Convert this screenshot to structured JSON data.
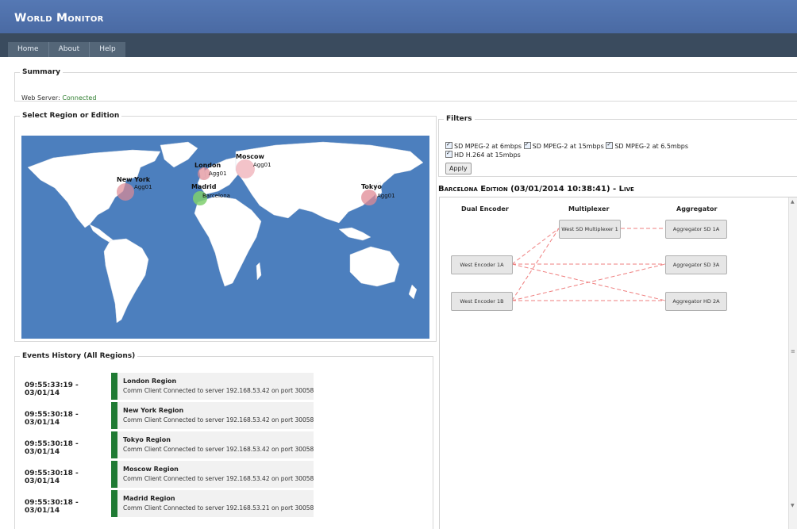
{
  "app": {
    "title": "World Monitor"
  },
  "nav": [
    "Home",
    "About",
    "Help"
  ],
  "summary": {
    "legend": "Summary",
    "web_server_label": "Web Server:",
    "web_server_status": "Connected"
  },
  "map": {
    "legend": "Select Region or Edition",
    "markers": [
      {
        "city": "New York",
        "agg": "Agg01"
      },
      {
        "city": "London",
        "agg": "Agg01"
      },
      {
        "city": "Moscow",
        "agg": "Agg01"
      },
      {
        "city": "Madrid",
        "agg": "Barcelona"
      },
      {
        "city": "Tokyo",
        "agg": "Agg01"
      }
    ],
    "colors": {
      "ocean": "#4c7fbe",
      "land": "#ffffff",
      "marker": "#e08a94",
      "selected": "#7fcf6f"
    }
  },
  "events": {
    "legend": "Events History (All Regions)",
    "items": [
      {
        "time": "09:55:33:19 - 03/01/14",
        "region": "London Region",
        "message": "Comm Client Connected to server 192.168.53.42 on port 30058"
      },
      {
        "time": "09:55:30:18 - 03/01/14",
        "region": "New York Region",
        "message": "Comm Client Connected to server 192.168.53.42 on port 30058"
      },
      {
        "time": "09:55:30:18 - 03/01/14",
        "region": "Tokyo Region",
        "message": "Comm Client Connected to server 192.168.53.42 on port 30058"
      },
      {
        "time": "09:55:30:18 - 03/01/14",
        "region": "Moscow Region",
        "message": "Comm Client Connected to server 192.168.53.42 on port 30058"
      },
      {
        "time": "09:55:30:18 - 03/01/14",
        "region": "Madrid Region",
        "message": "Comm Client Connected to server 192.168.53.21 on port 30058"
      }
    ],
    "status_color": "#1f7a33"
  },
  "filters": {
    "legend": "Filters",
    "options": [
      "SD MPEG-2 at 6mbps",
      "SD MPEG-2 at 15mbps",
      "SD MPEG-2 at 6.5mbps",
      "HD H.264 at 15mbps"
    ],
    "apply_label": "Apply"
  },
  "edition": {
    "title": "Barcelona Edition (03/01/2014 10:38:41) - Live",
    "columns": [
      "Dual Encoder",
      "Multiplexer",
      "Aggregator"
    ],
    "encoders": [
      "West Encoder 1A",
      "West Encoder 1B"
    ],
    "multiplexers": [
      "West SD Multiplexer 1"
    ],
    "aggregators": [
      "Aggregator SD 1A",
      "Aggregator SD 3A",
      "Aggregator HD 2A"
    ],
    "link_color": "#ef7f7f"
  }
}
